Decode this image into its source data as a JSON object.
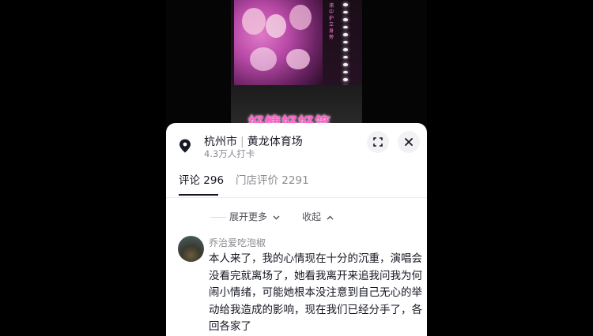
{
  "video": {
    "subtitle": "好慷好好笑",
    "side_label": "浦中护立身旁"
  },
  "location": {
    "city": "杭州市",
    "venue": "黄龙体育场",
    "checkins": "4.3万人打卡",
    "pin_icon": "location-pin-icon",
    "expand_icon": "expand-icon",
    "close_icon": "close-icon"
  },
  "tabs": [
    {
      "label": "评论",
      "count": "296"
    },
    {
      "label": "门店评价",
      "count": "2291"
    }
  ],
  "thread": {
    "expand_more": "展开更多",
    "collapse": "收起"
  },
  "comment": {
    "username": "乔治爱吃泡椒",
    "text": "本人来了，我的心情现在十分的沉重，演唱会没看完就离场了，她看我离开来追我问我为何闹小情绪，可能她根本没注意到自己无心的举动给我造成的影响，现在我们已经分手了，各回各家了"
  },
  "colors": {
    "text_primary": "#161823",
    "text_secondary": "#8a8b91",
    "subtitle_pink": "#ff5bc8"
  }
}
